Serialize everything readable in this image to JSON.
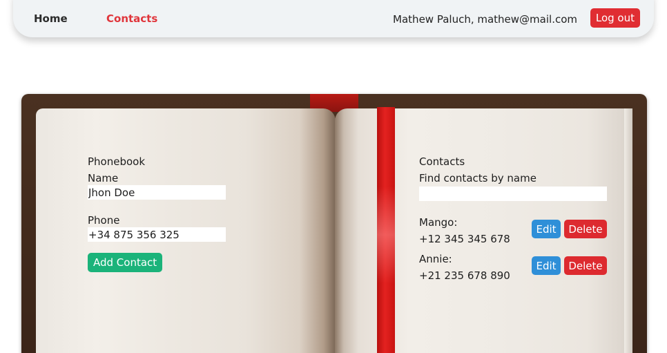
{
  "nav": {
    "home_label": "Home",
    "contacts_label": "Contacts",
    "user_info": "Mathew Paluch, mathew@mail.com",
    "logout_label": "Log out"
  },
  "form": {
    "title": "Phonebook",
    "name_label": "Name",
    "name_value": "Jhon Doe",
    "phone_label": "Phone",
    "phone_value": "+34 875 356 325",
    "add_label": "Add Contact"
  },
  "contacts": {
    "title": "Contacts",
    "filter_label": "Find contacts by name",
    "filter_value": "",
    "items": [
      {
        "name": "Mango:",
        "phone": "+12 345 345 678",
        "edit_label": "Edit",
        "delete_label": "Delete"
      },
      {
        "name": "Annie:",
        "phone": "+21 235 678 890",
        "edit_label": "Edit",
        "delete_label": "Delete"
      }
    ]
  },
  "colors": {
    "accent_red": "#e0353b",
    "logout_bg": "#e02d32",
    "add_button_bg": "#1bb37a",
    "edit_button_bg": "#2f8fd8",
    "delete_button_bg": "#dd2a2f",
    "header_bg": "#f0f3f5"
  }
}
